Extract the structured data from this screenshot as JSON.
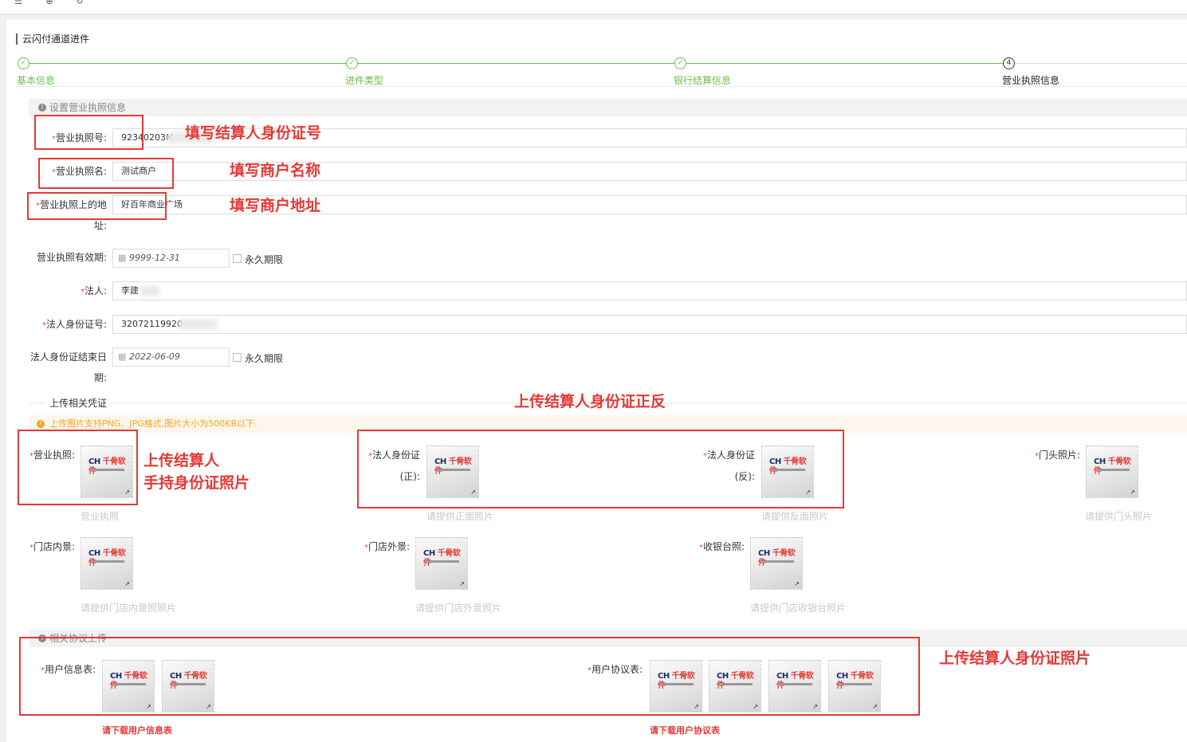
{
  "toolbar": {
    "icons": [
      "menu-icon",
      "globe-icon",
      "refresh-icon"
    ]
  },
  "page": {
    "title": "云闪付通道进件"
  },
  "steps": [
    {
      "number": "✓",
      "label": "基本信息",
      "status": "done"
    },
    {
      "number": "✓",
      "label": "进件类型",
      "status": "done"
    },
    {
      "number": "✓",
      "label": "银行结算信息",
      "status": "done"
    },
    {
      "number": "4",
      "label": "营业执照信息",
      "status": "current"
    }
  ],
  "license_section": {
    "title": "设置营业执照信息",
    "license_no": {
      "label": "营业执照号:",
      "value": "92340203M"
    },
    "license_name": {
      "label": "营业执照名:",
      "value": "测试商户"
    },
    "license_address": {
      "label_line1": "营业执照上的地",
      "label_line2": "址:",
      "value": "好百年商业广场"
    },
    "license_validity": {
      "label": "营业执照有效期:",
      "value": "9999-12-31",
      "permanent_label": "永久期限"
    },
    "legal_person": {
      "label": "法人:",
      "value": "李建"
    },
    "legal_id": {
      "label": "法人身份证号:",
      "value": "32072119920"
    },
    "legal_id_end": {
      "label_line1": "法人身份证结束日",
      "label_line2": "期:",
      "value": "2022-06-09",
      "permanent_label": "永久期限"
    }
  },
  "upload_section": {
    "title": "上传相关凭证",
    "tip": "上传图片支持PNG、JPG格式,图片大小为500KB以下.",
    "items": [
      {
        "label": "营业执照:",
        "hint": "营业执照"
      },
      {
        "label_line1": "法人身份证",
        "label_line2": "(正):",
        "hint": "请提供正面照片"
      },
      {
        "label_line1": "法人身份证",
        "label_line2": "(反):",
        "hint": "请提供反面照片"
      },
      {
        "label": "门头照片:",
        "hint": "请提供门头照片"
      },
      {
        "label": "门店内景:",
        "hint": "请提供门店内景照照片"
      },
      {
        "label": "门店外景:",
        "hint": "请提供门店外景照片"
      },
      {
        "label": "收银台照:",
        "hint": "请提供门店收银台照片"
      }
    ],
    "thumb_logo": "千骨软件"
  },
  "agreement_section": {
    "title": "相关协议上传",
    "user_info_label": "用户信息表:",
    "user_info_download": "请下载用户信息表",
    "user_agreement_label": "用户协议表:",
    "user_agreement_download": "请下载用户协议表"
  },
  "annotations": {
    "a1": "填写结算人身份证号",
    "a2": "填写商户名称",
    "a3": "填写商户地址",
    "a4": "上传结算人身份证正反",
    "a5_line1": "上传结算人",
    "a5_line2": "手持身份证照片",
    "a6": "上传结算人身份证照片"
  },
  "colors": {
    "accent_green": "#6abf4b",
    "annotation_red": "#e53935",
    "tip_orange": "#f5a623"
  }
}
